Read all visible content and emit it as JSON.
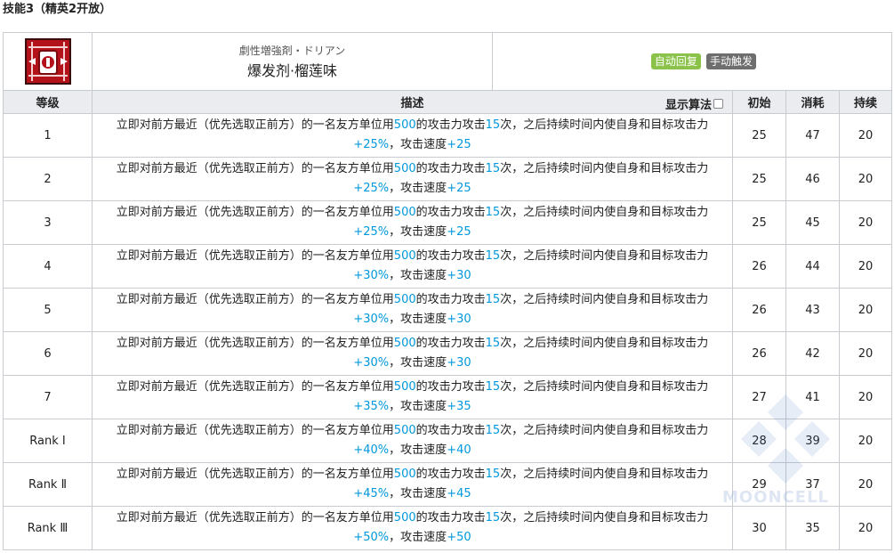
{
  "section_title": "技能3（精英2开放）",
  "skill": {
    "icon": "skill-icon",
    "name_jp": "劇性増強剤・ドリアン",
    "name_cn": "爆发剂·榴莲味",
    "tags": [
      "自动回复",
      "手动触发"
    ]
  },
  "colors": {
    "tag_auto": "#8bc34a",
    "tag_manual": "#6e6e6e",
    "highlight": "#0098dc",
    "header_bg": "#eaecf0"
  },
  "columns": {
    "level": "等级",
    "desc": "描述",
    "algo_toggle": "显示算法",
    "initial": "初始",
    "cost": "消耗",
    "duration": "持续"
  },
  "desc_parts": {
    "p1": "立即对前方最近（优先选取正前方）的一名友方单位用",
    "atk_value": "500",
    "p2": "的攻击力攻击",
    "hits": "15",
    "p3": "次，之后持续时间内使自身和目标攻击力",
    "p4": "，攻击速度"
  },
  "rows": [
    {
      "level": "1",
      "atk_pct": "+25%",
      "aspd": "+25",
      "initial": "25",
      "cost": "47",
      "duration": "20"
    },
    {
      "level": "2",
      "atk_pct": "+25%",
      "aspd": "+25",
      "initial": "25",
      "cost": "46",
      "duration": "20"
    },
    {
      "level": "3",
      "atk_pct": "+25%",
      "aspd": "+25",
      "initial": "25",
      "cost": "45",
      "duration": "20"
    },
    {
      "level": "4",
      "atk_pct": "+30%",
      "aspd": "+30",
      "initial": "26",
      "cost": "44",
      "duration": "20"
    },
    {
      "level": "5",
      "atk_pct": "+30%",
      "aspd": "+30",
      "initial": "26",
      "cost": "43",
      "duration": "20"
    },
    {
      "level": "6",
      "atk_pct": "+30%",
      "aspd": "+30",
      "initial": "26",
      "cost": "42",
      "duration": "20"
    },
    {
      "level": "7",
      "atk_pct": "+35%",
      "aspd": "+35",
      "initial": "27",
      "cost": "41",
      "duration": "20"
    },
    {
      "level": "Rank Ⅰ",
      "atk_pct": "+40%",
      "aspd": "+40",
      "initial": "28",
      "cost": "39",
      "duration": "20"
    },
    {
      "level": "Rank Ⅱ",
      "atk_pct": "+45%",
      "aspd": "+45",
      "initial": "29",
      "cost": "37",
      "duration": "20"
    },
    {
      "level": "Rank Ⅲ",
      "atk_pct": "+50%",
      "aspd": "+50",
      "initial": "30",
      "cost": "35",
      "duration": "20"
    }
  ],
  "watermark": "MOONCELL"
}
